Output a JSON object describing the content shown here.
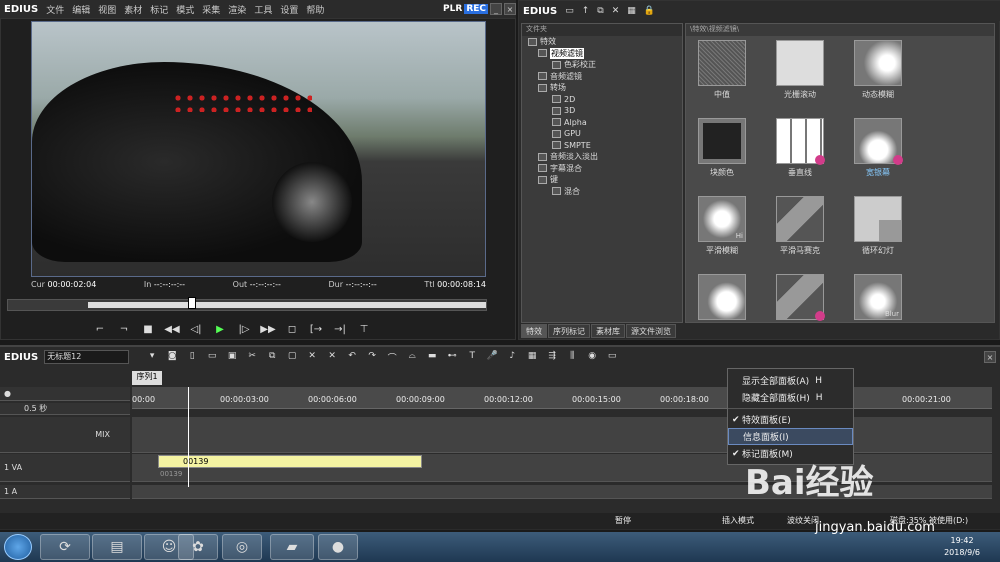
{
  "app": {
    "logo": "EDIUS",
    "menu": [
      "文件",
      "编辑",
      "视图",
      "素材",
      "标记",
      "模式",
      "采集",
      "渲染",
      "工具",
      "设置",
      "帮助"
    ],
    "plr": "PLR",
    "rec": "REC"
  },
  "player": {
    "cur_label": "Cur",
    "cur": "00:00:02:04",
    "in_label": "In",
    "in": "--:--:--:--",
    "out_label": "Out",
    "out": "--:--:--:--",
    "dur_label": "Dur",
    "dur": "--:--:--:--",
    "ttl_label": "Ttl",
    "ttl": "00:00:08:14"
  },
  "bin": {
    "logo": "EDIUS",
    "tree_header": "文件夹",
    "grid_header": "\\特效\\视频滤镜\\",
    "tree": [
      "特效",
      "视频滤镜",
      "色彩校正",
      "音频滤镜",
      "转场",
      "2D",
      "3D",
      "Alpha",
      "GPU",
      "SMPTE",
      "音频淡入淡出",
      "字幕混合",
      "键",
      "混合"
    ],
    "tiles": [
      "中值",
      "光栅滚动",
      "动态模糊",
      "块颜色",
      "垂直线",
      "宽银幕",
      "平滑模糊",
      "平滑马赛克",
      "循环幻灯",
      "",
      ""
    ],
    "tiles_overlay": {
      "hi": "Hi",
      "blur": "Blur"
    },
    "tabs": [
      "特效",
      "序列标记",
      "素材库",
      "源文件浏览"
    ]
  },
  "timeline": {
    "logo": "EDIUS",
    "project": "无标题12",
    "seq_tab": "序列1",
    "zoom": "0.5 秒",
    "ruler": [
      "00:00",
      "00:00:03:00",
      "00:00:06:00",
      "00:00:09:00",
      "00:00:12:00",
      "00:00:15:00",
      "00:00:18:00",
      "00:00:21:00"
    ],
    "tracks": {
      "mix": "MIX",
      "va": "1 VA",
      "a": "1 A"
    },
    "clip": "00139",
    "clip_sub": "00139",
    "status": {
      "pause": "暂停",
      "insert": "插入模式",
      "ripple": "波纹关闭",
      "disk": "磁盘:35% 被使用(D:)"
    }
  },
  "context_menu": [
    {
      "label": "显示全部面板(A)",
      "key": "H",
      "checked": false
    },
    {
      "label": "隐藏全部面板(H)",
      "key": "H",
      "checked": false
    },
    {
      "label": "特效面板(E)",
      "key": "",
      "checked": true
    },
    {
      "label": "信息面板(I)",
      "key": "",
      "checked": false
    },
    {
      "label": "标记面板(M)",
      "key": "",
      "checked": true
    }
  ],
  "taskbar": {
    "time": "19:42",
    "date": "2018/9/6"
  },
  "watermark": {
    "main": "Bai经验",
    "url": "jingyan.baidu.com"
  }
}
